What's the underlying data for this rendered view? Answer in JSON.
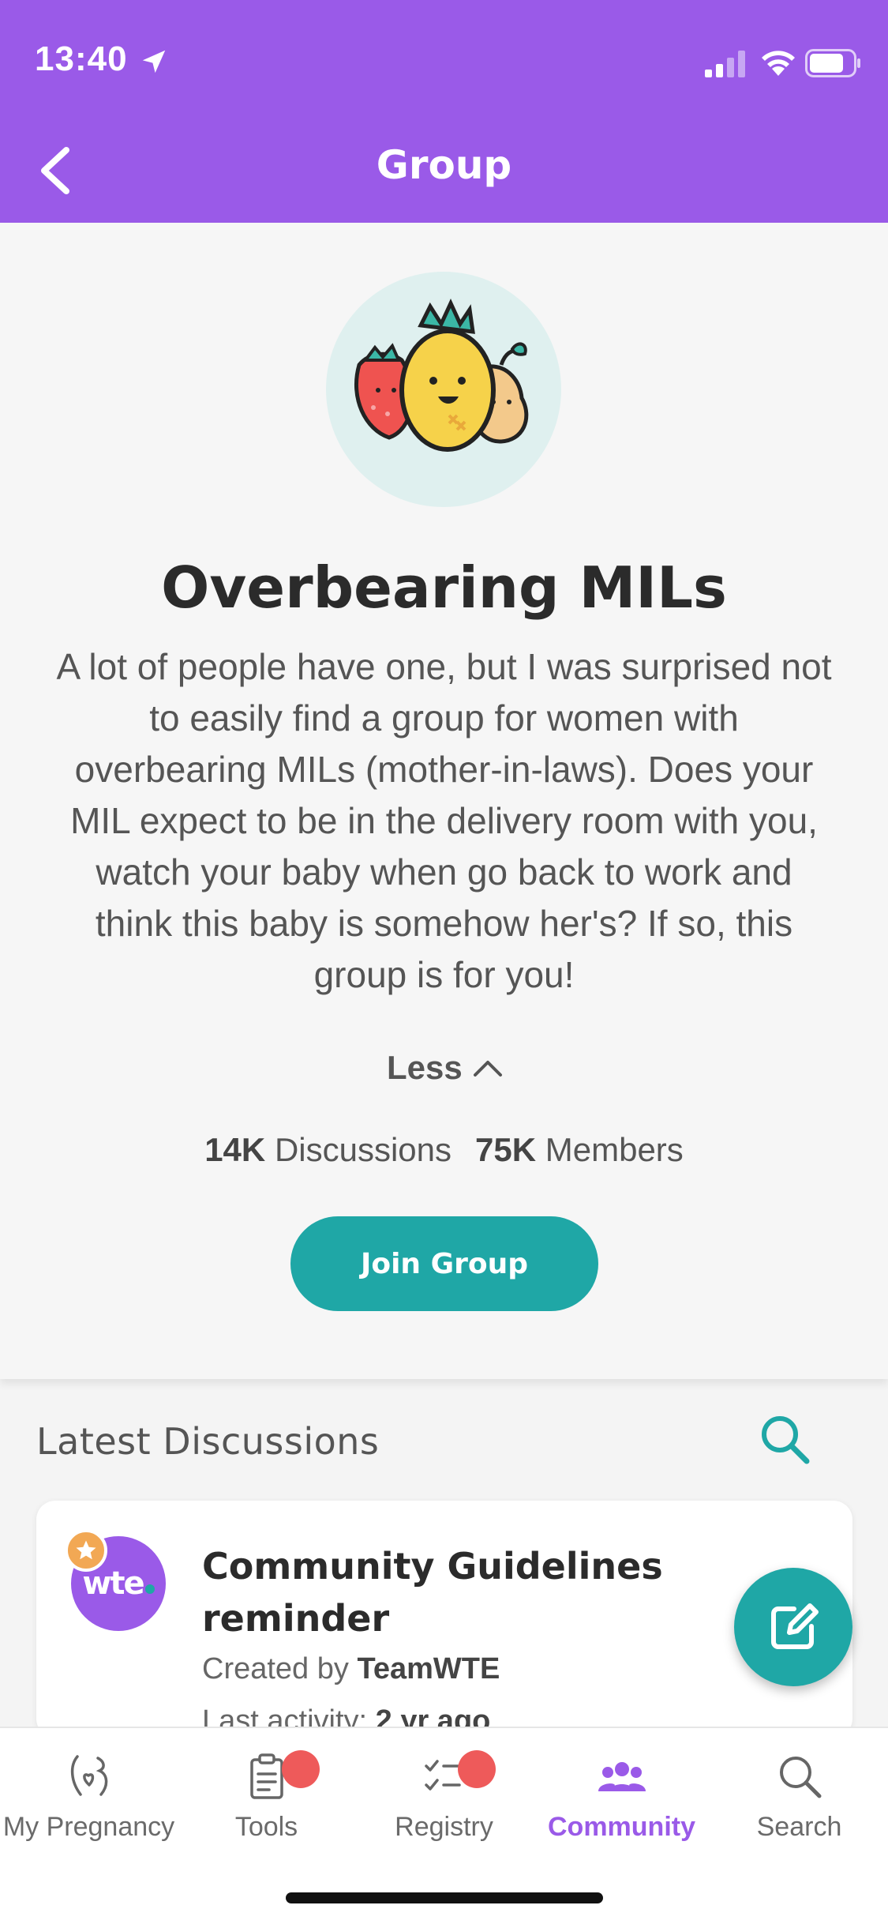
{
  "status_bar": {
    "time": "13:40"
  },
  "header": {
    "title": "Group"
  },
  "group": {
    "name": "Overbearing MILs",
    "description": "A lot of people have one, but I was surprised not to easily find a group for women with overbearing MILs (mother-in-laws). Does your MIL expect to be in the delivery room with you, watch your baby when go back to work and think this baby is somehow her's? If so, this group is for you!",
    "toggle_label": "Less",
    "discussions_count": "14K",
    "discussions_label": "Discussions",
    "members_count": "75K",
    "members_label": "Members",
    "join_label": "Join Group"
  },
  "latest": {
    "title": "Latest Discussions",
    "items": [
      {
        "avatar_text": "wte",
        "title": "Community Guidelines reminder",
        "created_prefix": "Created by",
        "author": "TeamWTE",
        "activity_prefix": "Last activity:",
        "activity_value": "2 yr ago"
      }
    ]
  },
  "tabs": [
    {
      "label": "My Pregnancy",
      "icon": "pregnancy-icon",
      "active": false
    },
    {
      "label": "Tools",
      "icon": "clipboard-icon",
      "active": false,
      "badge": true
    },
    {
      "label": "Registry",
      "icon": "checklist-icon",
      "active": false,
      "badge": true
    },
    {
      "label": "Community",
      "icon": "people-icon",
      "active": true
    },
    {
      "label": "Search",
      "icon": "search-icon",
      "active": false
    }
  ],
  "colors": {
    "brand_purple": "#9a5ae8",
    "teal": "#1fa7a6",
    "badge_red": "#ee5a5a",
    "star_orange": "#f2a854"
  }
}
